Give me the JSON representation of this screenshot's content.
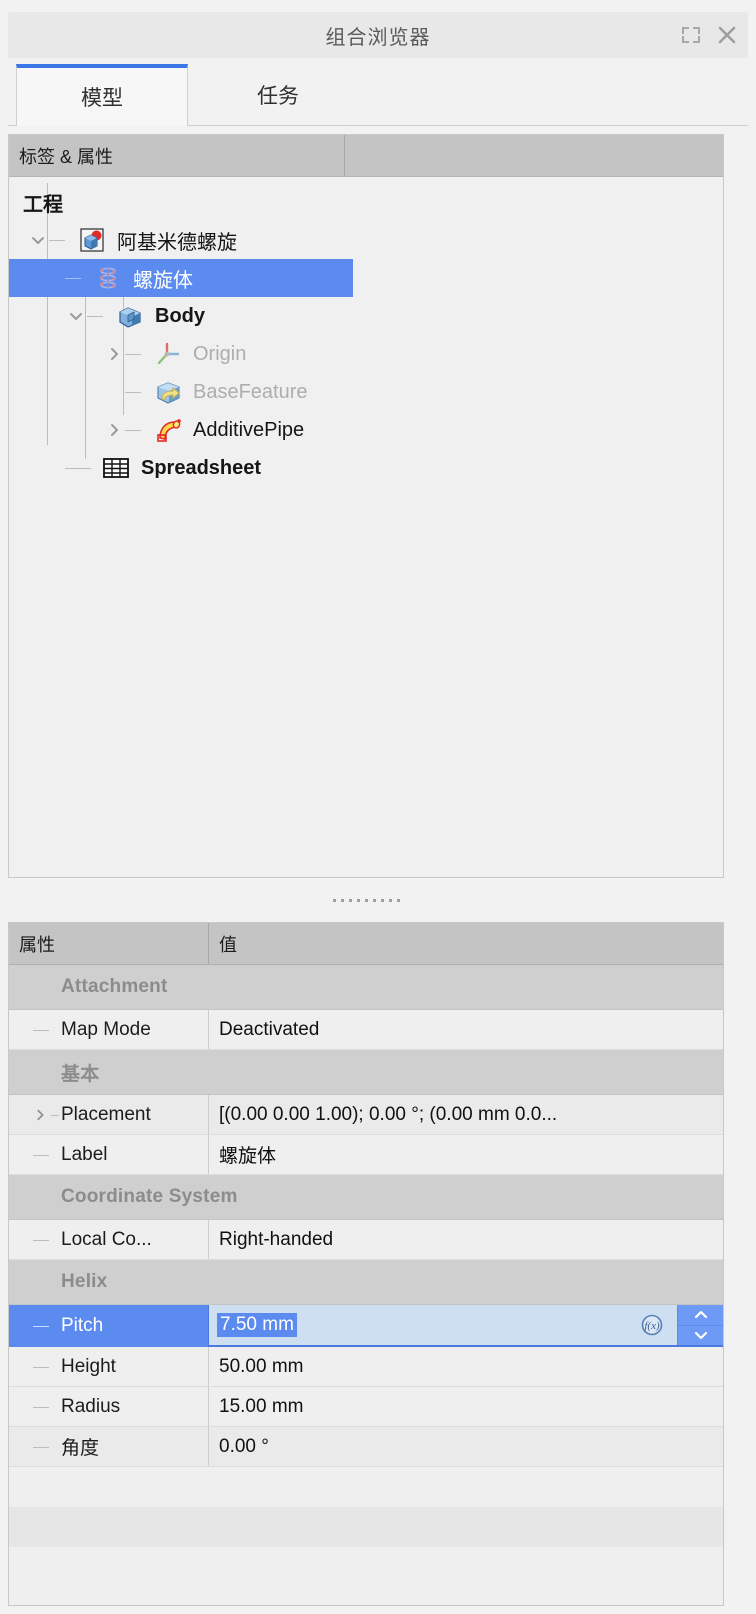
{
  "window": {
    "title": "组合浏览器",
    "float_icon": "float-icon",
    "close_icon": "close-icon"
  },
  "tabs": [
    {
      "label": "模型",
      "active": true
    },
    {
      "label": "任务",
      "active": false
    }
  ],
  "tree": {
    "columns": [
      "标签 & 属性",
      ""
    ],
    "items": [
      {
        "label": "工程",
        "icon": "application-icon",
        "depth": 0,
        "style": "bold",
        "arrow": "none"
      },
      {
        "label": "阿基米德螺旋",
        "icon": "document-icon",
        "depth": 1,
        "style": "normal",
        "arrow": "expanded"
      },
      {
        "label": "螺旋体",
        "icon": "helix-icon",
        "depth": 2,
        "style": "selected",
        "arrow": "none"
      },
      {
        "label": "Body",
        "icon": "body-icon",
        "depth": 2,
        "style": "bold",
        "arrow": "expanded"
      },
      {
        "label": "Origin",
        "icon": "origin-icon",
        "depth": 3,
        "style": "muted",
        "arrow": "collapsed"
      },
      {
        "label": "BaseFeature",
        "icon": "basefeature-icon",
        "depth": 3,
        "style": "muted",
        "arrow": "none"
      },
      {
        "label": "AdditivePipe",
        "icon": "additivepipe-icon",
        "depth": 3,
        "style": "normal",
        "arrow": "collapsed"
      },
      {
        "label": "Spreadsheet",
        "icon": "spreadsheet-icon",
        "depth": 2,
        "style": "bold",
        "arrow": "none"
      }
    ]
  },
  "properties": {
    "columns": [
      "属性",
      "值"
    ],
    "rows": [
      {
        "kind": "group",
        "label": "Attachment"
      },
      {
        "kind": "prop",
        "name": "Map Mode",
        "value": "Deactivated",
        "expandable": false
      },
      {
        "kind": "group",
        "label": "基本"
      },
      {
        "kind": "prop",
        "name": "Placement",
        "value": "[(0.00 0.00 1.00); 0.00 °; (0.00 mm  0.0...",
        "expandable": true
      },
      {
        "kind": "prop",
        "name": "Label",
        "value": "螺旋体",
        "expandable": false
      },
      {
        "kind": "group",
        "label": "Coordinate  System"
      },
      {
        "kind": "prop",
        "name": "Local Co...",
        "value": "Right-handed",
        "expandable": false
      },
      {
        "kind": "group",
        "label": "Helix"
      },
      {
        "kind": "editing",
        "name": "Pitch",
        "value": "7.50 mm",
        "expression_icon": "fx-icon",
        "spinner": "spinner-updown"
      },
      {
        "kind": "prop",
        "name": "Height",
        "value": "50.00 mm",
        "expandable": false
      },
      {
        "kind": "prop",
        "name": "Radius",
        "value": "15.00 mm",
        "expandable": false
      },
      {
        "kind": "prop",
        "name": "角度",
        "value": "0.00 °",
        "expandable": false
      }
    ]
  },
  "colors": {
    "selection": "#5c8bf0",
    "tab_accent": "#3b78e7",
    "group_header": "#cfcfcf",
    "column_header": "#c4c4c4"
  }
}
